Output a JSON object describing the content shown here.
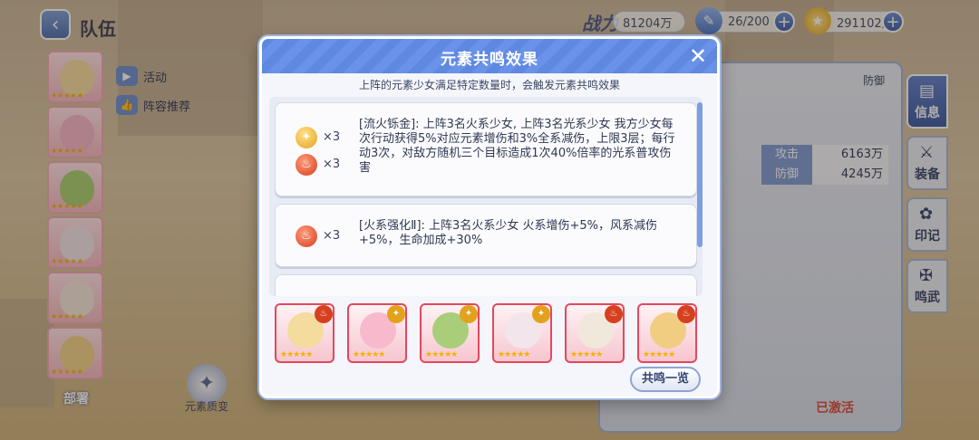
{
  "header": {
    "title": "队伍",
    "power_label": "战力",
    "power_value": "81204万",
    "stamina": "26/200",
    "gold": "291102万"
  },
  "sidebar": {
    "tabs": [
      {
        "label": "活动"
      },
      {
        "label": "阵容推荐"
      }
    ],
    "deploy_label": "部署",
    "element_change_label": "元素质变"
  },
  "right_panel": {
    "role": "防御",
    "stats": [
      {
        "label": "攻击",
        "value": "6163万"
      },
      {
        "label": "防御",
        "value": "4245万"
      }
    ],
    "tabs": [
      {
        "label": "信息"
      },
      {
        "label": "装备"
      },
      {
        "label": "印记"
      },
      {
        "label": "鸣武"
      }
    ],
    "activated_label": "已激活"
  },
  "modal": {
    "title": "元素共鸣效果",
    "subtitle": "上阵的元素少女满足特定数量时，会触发元素共鸣效果",
    "effects": [
      {
        "requirements": [
          {
            "element": "light",
            "multiplier": "×3"
          },
          {
            "element": "fire",
            "multiplier": "×3"
          }
        ],
        "text": "[流火铄金]: 上阵3名火系少女, 上阵3名光系少女 我方少女每次行动获得5%对应元素增伤和3%全系减伤，上限3层；每行动3次，对敌方随机三个目标造成1次40%倍率的光系普攻伤害"
      },
      {
        "requirements": [
          {
            "element": "fire",
            "multiplier": "×3"
          }
        ],
        "text": "[火系强化Ⅱ]: 上阵3名火系少女 火系增伤+5%，风系减伤+5%，生命加成+30%"
      }
    ],
    "heroes": [
      {
        "element": "fire",
        "stars": 5
      },
      {
        "element": "light",
        "stars": 5
      },
      {
        "element": "light",
        "stars": 5
      },
      {
        "element": "light",
        "stars": 5
      },
      {
        "element": "fire",
        "stars": 5
      },
      {
        "element": "fire",
        "stars": 5
      }
    ],
    "overview_button": "共鸣一览",
    "close_icon": "close-icon"
  },
  "colors": {
    "accent": "#5f88e0",
    "fire": "#d6401e",
    "light": "#e4a21c",
    "activated": "#d94a3a"
  }
}
